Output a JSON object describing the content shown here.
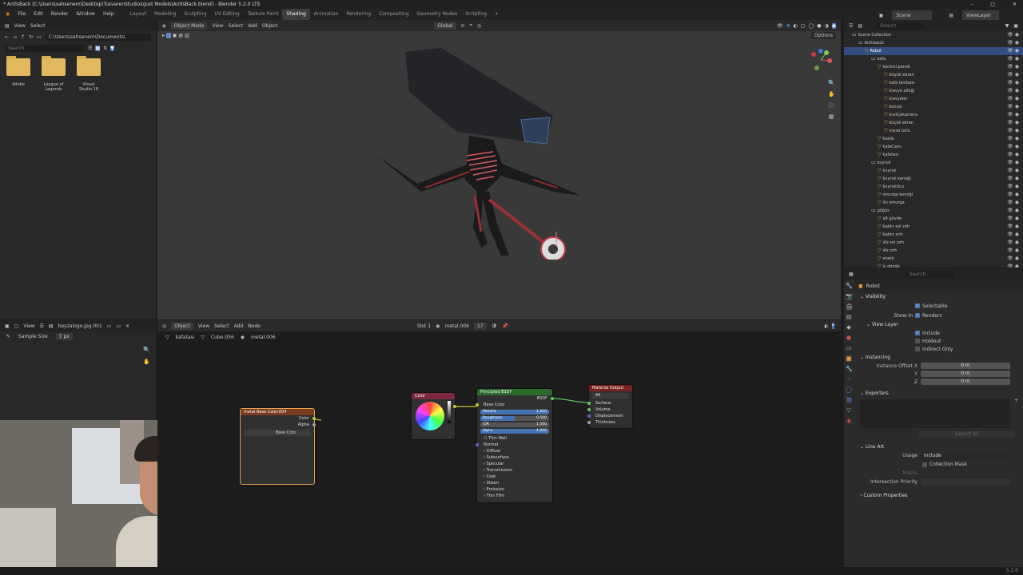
{
  "window": {
    "title": "* AntlsBack [C:\\Users\\sahsenem\\Desktop\\TusvarenStudios\\Just Models\\AntlsBack.blend] - Blender 5.2.0 LTS"
  },
  "menubar": {
    "items": [
      "File",
      "Edit",
      "Render",
      "Window",
      "Help"
    ],
    "workspaces": [
      "Layout",
      "Modeling",
      "Sculpting",
      "UV Editing",
      "Texture Paint",
      "Shading",
      "Animation",
      "Rendering",
      "Compositing",
      "Geometry Nodes",
      "Scripting"
    ],
    "active_workspace": "Shading",
    "scene": "Scene",
    "view_layer": "ViewLayer"
  },
  "filebrowser": {
    "menu": [
      "View",
      "Select"
    ],
    "path": "C:\\Users\\sahsenem\\Documents\\",
    "search_placeholder": "Search",
    "folders": [
      "Adobe",
      "League of Legends",
      "Visual Studio 18"
    ]
  },
  "viewport": {
    "mode": "Object Mode",
    "menu": [
      "View",
      "Select",
      "Add",
      "Object"
    ],
    "orientation": "Global",
    "options": "Options"
  },
  "image_editor": {
    "menu": "View",
    "image": "beyzalogo.jpg.001",
    "sample_label": "Sample Size",
    "sample_value": "1 px"
  },
  "node_editor": {
    "mode": "Object",
    "menu": [
      "View",
      "Select",
      "Add",
      "Node"
    ],
    "slot": "Slot 1",
    "material": "metal.006",
    "users": "17",
    "breadcrumb": [
      "kafatası",
      "Cube.056",
      "metal.006"
    ],
    "nodes": {
      "image": {
        "title": "metal Base Color.004",
        "outputs": [
          "Color",
          "Alpha"
        ],
        "field": "Base Colo"
      },
      "color": {
        "title": "Color"
      },
      "bsdf": {
        "title": "Principled BSDF",
        "output": "BSDF",
        "base": "Base Color",
        "sliders": [
          {
            "label": "Metallic",
            "value": "1.000"
          },
          {
            "label": "Roughness",
            "value": "0.500"
          },
          {
            "label": "IOR",
            "value": "1.500"
          },
          {
            "label": "Alpha",
            "value": "1.000"
          }
        ],
        "thin_wall": "Thin Wall",
        "normal": "Normal",
        "panels": [
          "Diffuse",
          "Subsurface",
          "Specular",
          "Transmission",
          "Coat",
          "Sheen",
          "Emission",
          "Thin Film"
        ]
      },
      "output": {
        "title": "Material Output",
        "target": "All",
        "inputs": [
          "Surface",
          "Volume",
          "Displacement",
          "Thickness"
        ]
      }
    }
  },
  "outliner": {
    "search_placeholder": "Search",
    "rows": [
      {
        "label": "Scene Collection",
        "indent": 0,
        "selected": false
      },
      {
        "label": "Antlsback",
        "indent": 1,
        "selected": false
      },
      {
        "label": "Robot",
        "indent": 2,
        "selected": true
      },
      {
        "label": "kafa",
        "indent": 3,
        "selected": false
      },
      {
        "label": "kontrol paneli",
        "indent": 4,
        "selected": false
      },
      {
        "label": "büyük ekran",
        "indent": 5,
        "selected": false
      },
      {
        "label": "kafa lambası",
        "indent": 5,
        "selected": false
      },
      {
        "label": "klavye altlığı",
        "indent": 5,
        "selected": false
      },
      {
        "label": "klavyeler",
        "indent": 5,
        "selected": false
      },
      {
        "label": "konsol",
        "indent": 5,
        "selected": false
      },
      {
        "label": "kraliçekamera",
        "indent": 5,
        "selected": false
      },
      {
        "label": "küçük ekran",
        "indent": 5,
        "selected": false
      },
      {
        "label": "masa üstü",
        "indent": 5,
        "selected": false
      },
      {
        "label": "baslık",
        "indent": 4,
        "selected": false
      },
      {
        "label": "kafaCamı",
        "indent": 4,
        "selected": false
      },
      {
        "label": "kafatası",
        "indent": 4,
        "selected": false
      },
      {
        "label": "kuyruk",
        "indent": 3,
        "selected": false
      },
      {
        "label": "kuyruk",
        "indent": 4,
        "selected": false
      },
      {
        "label": "kuyruk kemiği",
        "indent": 4,
        "selected": false
      },
      {
        "label": "kuyrukUcu",
        "indent": 4,
        "selected": false
      },
      {
        "label": "omurga kemiği",
        "indent": 4,
        "selected": false
      },
      {
        "label": "ön omurga",
        "indent": 4,
        "selected": false
      },
      {
        "label": "göğüs",
        "indent": 3,
        "selected": false
      },
      {
        "label": "alt gövde",
        "indent": 4,
        "selected": false
      },
      {
        "label": "baldır sol zırh",
        "indent": 4,
        "selected": false
      },
      {
        "label": "baldır zırh",
        "indent": 4,
        "selected": false
      },
      {
        "label": "diz sol zırh",
        "indent": 4,
        "selected": false
      },
      {
        "label": "diz zırh",
        "indent": 4,
        "selected": false
      },
      {
        "label": "enerji",
        "indent": 4,
        "selected": false
      },
      {
        "label": "iç gövde",
        "indent": 4,
        "selected": false
      }
    ]
  },
  "properties": {
    "search_placeholder": "Search",
    "object_name": "Robot",
    "sections": {
      "visibility": "Visibility",
      "selectable": "Selectable",
      "show_in": "Show In",
      "renders": "Renders",
      "view_layer": "View Layer",
      "include": "Include",
      "holdout": "Holdout",
      "indirect_only": "Indirect Only",
      "instancing": "Instancing",
      "instance_offset": "Instance Offset X",
      "y": "Y",
      "z": "Z",
      "offset_x": "0 m",
      "offset_y": "0 m",
      "offset_z": "0 m",
      "exporters": "Exporters",
      "export_all": "Export All",
      "line_art": "Line Art",
      "usage_label": "Usage",
      "usage_value": "Include",
      "collection_mask": "Collection Mask",
      "masks": "Masks",
      "intersection_priority": "Intersection Priority",
      "custom_properties": "Custom Properties"
    }
  },
  "status": {
    "version": "5.2.0"
  }
}
